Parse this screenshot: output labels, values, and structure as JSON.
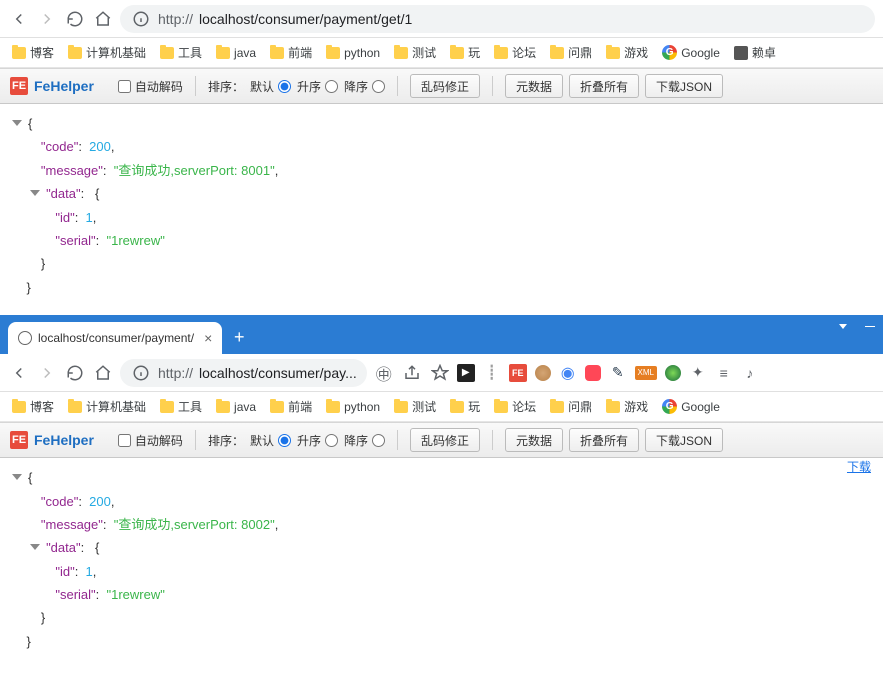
{
  "nav": {
    "url_http": "http://",
    "url_path": "localhost/consumer/payment/get/1"
  },
  "bookmarks": [
    "博客",
    "计算机基础",
    "工具",
    "java",
    "前端",
    "python",
    "测试",
    "玩",
    "论坛",
    "问鼎",
    "游戏"
  ],
  "google_label": "Google",
  "avatar_label": "赖卓",
  "fe": {
    "title": "FeHelper",
    "auto_decode": "自动解码",
    "sort_label": "排序：",
    "sort_default": "默认",
    "sort_asc": "升序",
    "sort_desc": "降序",
    "btn_fix": "乱码修正",
    "btn_meta": "元数据",
    "btn_fold": "折叠所有",
    "btn_json": "下载JSON"
  },
  "json1": {
    "code_key": "\"code\"",
    "code_val": "200",
    "msg_key": "\"message\"",
    "msg_val": "\"查询成功,serverPort: 8001\"",
    "data_key": "\"data\"",
    "id_key": "\"id\"",
    "id_val": "1",
    "serial_key": "\"serial\"",
    "serial_val": "\"1rewrew\""
  },
  "tab2": {
    "title": "localhost/consumer/payment/",
    "url_http": "http://",
    "url_short": "localhost/consumer/pay..."
  },
  "json2": {
    "code_key": "\"code\"",
    "code_val": "200",
    "msg_key": "\"message\"",
    "msg_val": "\"查询成功,serverPort: 8002\"",
    "data_key": "\"data\"",
    "id_key": "\"id\"",
    "id_val": "1",
    "serial_key": "\"serial\"",
    "serial_val": "\"1rewrew\""
  },
  "download_label": "下载"
}
